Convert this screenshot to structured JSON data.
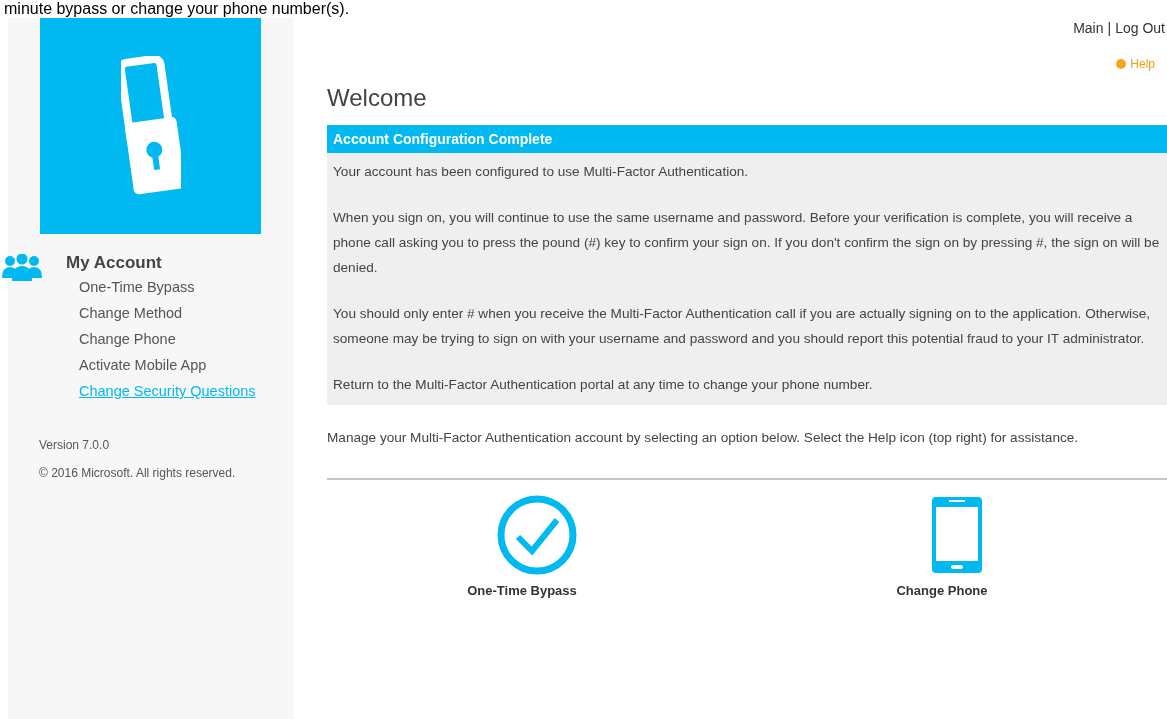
{
  "caption": "minute bypass or change your phone number(s).",
  "header": {
    "links": [
      "Main",
      "Log Out"
    ],
    "separator": "|",
    "help": "Help"
  },
  "sidebar": {
    "section_title": "My Account",
    "items": [
      {
        "label": "One-Time Bypass",
        "selected": false
      },
      {
        "label": "Change Method",
        "selected": false
      },
      {
        "label": "Change Phone",
        "selected": false
      },
      {
        "label": "Activate Mobile App",
        "selected": false
      },
      {
        "label": "Change Security Questions",
        "selected": true
      }
    ],
    "version": "Version 7.0.0",
    "copyright": "© 2016 Microsoft. All rights reserved."
  },
  "title": "Welcome",
  "alert": {
    "title": "Account Configuration Complete",
    "paragraphs": [
      "Your account has been configured to use Multi-Factor Authentication.",
      "When you sign on, you will continue to use the same username and password. Before your verification is complete, you will receive a phone call asking you to press the pound (#) key to confirm your sign on. If you don't confirm the sign on by pressing #, the sign on will be denied.",
      "You should only enter # when you receive the Multi-Factor Authentication call if you are actually signing on to the application. Otherwise, someone may be trying to sign on with your username and password and you should report this potential fraud to your IT administrator.",
      "Return to the Multi-Factor Authentication portal at any time to change your phone number."
    ]
  },
  "intro": "Manage your Multi-Factor Authentication account by selecting an option below. Select the Help icon (top right) for assistance.",
  "options": [
    {
      "kind": "check",
      "label": "One-Time Bypass"
    },
    {
      "kind": "phone",
      "label": "Change Phone"
    }
  ]
}
